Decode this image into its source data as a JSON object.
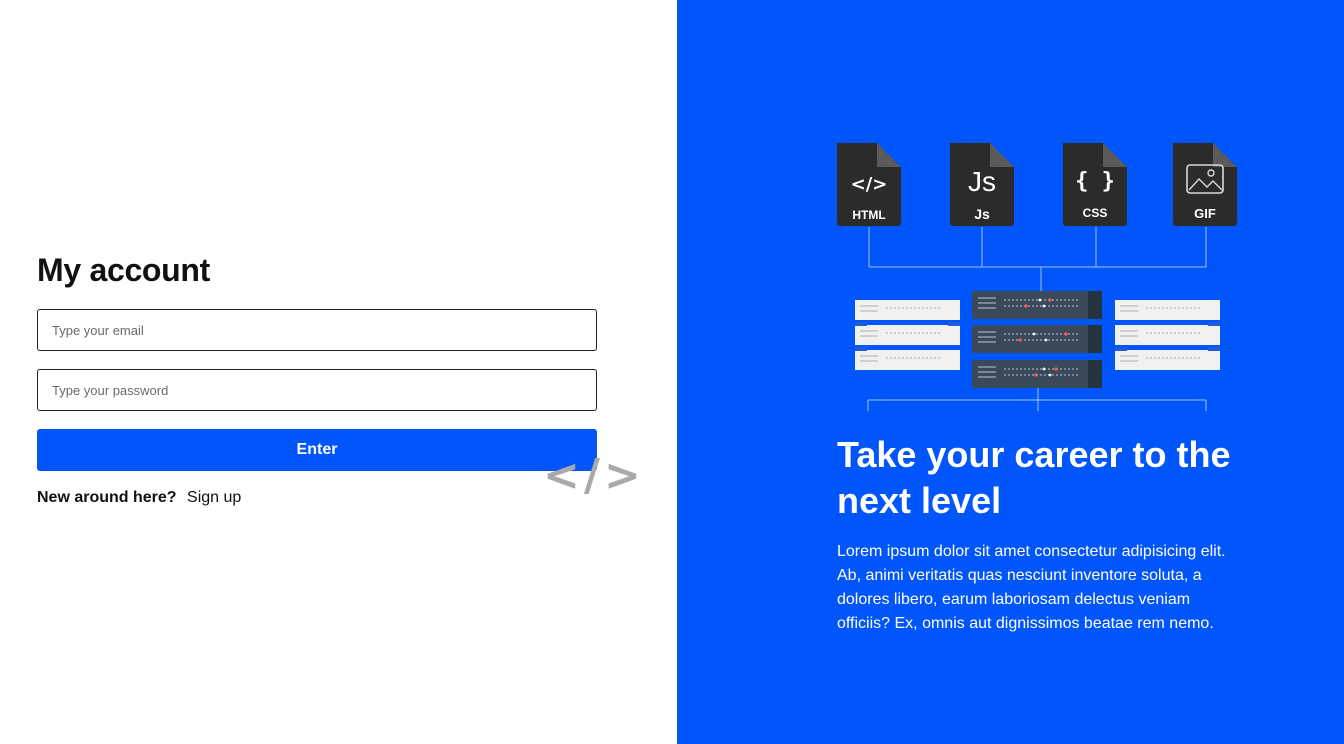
{
  "login": {
    "title": "My account",
    "email_placeholder": "Type your email",
    "password_placeholder": "Type your password",
    "enter_label": "Enter",
    "signup_question": "New around here?",
    "signup_link": "Sign up",
    "decor_code_symbol": "</>"
  },
  "promo": {
    "files": [
      {
        "glyph": "</>",
        "label": "HTML"
      },
      {
        "glyph": "Js",
        "label": "Js"
      },
      {
        "glyph": "{ }",
        "label": "CSS"
      },
      {
        "glyph": "image",
        "label": "GIF"
      }
    ],
    "headline": "Take your career to the next level",
    "description": "Lorem ipsum dolor sit amet consectetur adipisicing elit. Ab, animi veritatis quas nesciunt inventore soluta, a dolores libero, earum laboriosam delectus veniam officiis? Ex, omnis aut dignissimos beatae rem nemo."
  },
  "colors": {
    "accent": "#0055fb",
    "background": "#ffffff",
    "file_icon": "#2b2b2b",
    "server_dark": "#3a4a5a",
    "server_light": "#f1f1f1"
  }
}
